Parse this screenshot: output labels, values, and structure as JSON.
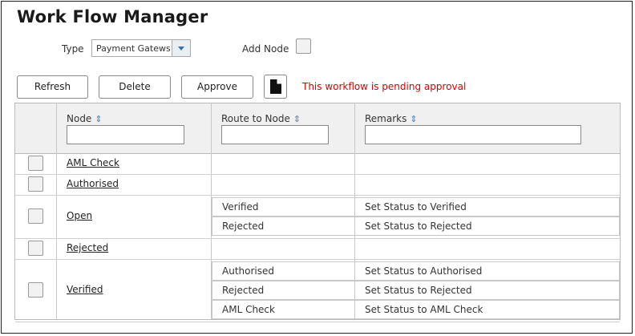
{
  "title": "Work Flow Manager",
  "type_label": "Type",
  "type_value": "Payment Gatews",
  "add_node_label": "Add Node",
  "buttons": {
    "refresh": "Refresh",
    "delete": "Delete",
    "approve": "Approve"
  },
  "doc_icon": "document-icon",
  "pending_message": "This workflow is pending approval",
  "pending_color": "#e00000",
  "columns": {
    "node": "Node",
    "route": "Route to Node",
    "remarks": "Remarks"
  },
  "sort_icon": "sort-icon",
  "rows": [
    {
      "node": "AML Check",
      "routes": []
    },
    {
      "node": "Authorised",
      "routes": []
    },
    {
      "node": "Open",
      "routes": [
        {
          "route": "Verified",
          "remark": "Set Status to Verified"
        },
        {
          "route": "Rejected",
          "remark": "Set Status to Rejected"
        }
      ]
    },
    {
      "node": "Rejected",
      "routes": []
    },
    {
      "node": "Verified",
      "routes": [
        {
          "route": "Authorised",
          "remark": "Set Status to Authorised"
        },
        {
          "route": "Rejected",
          "remark": "Set Status to Rejected"
        },
        {
          "route": "AML Check",
          "remark": "Set Status to AML Check"
        }
      ]
    }
  ]
}
